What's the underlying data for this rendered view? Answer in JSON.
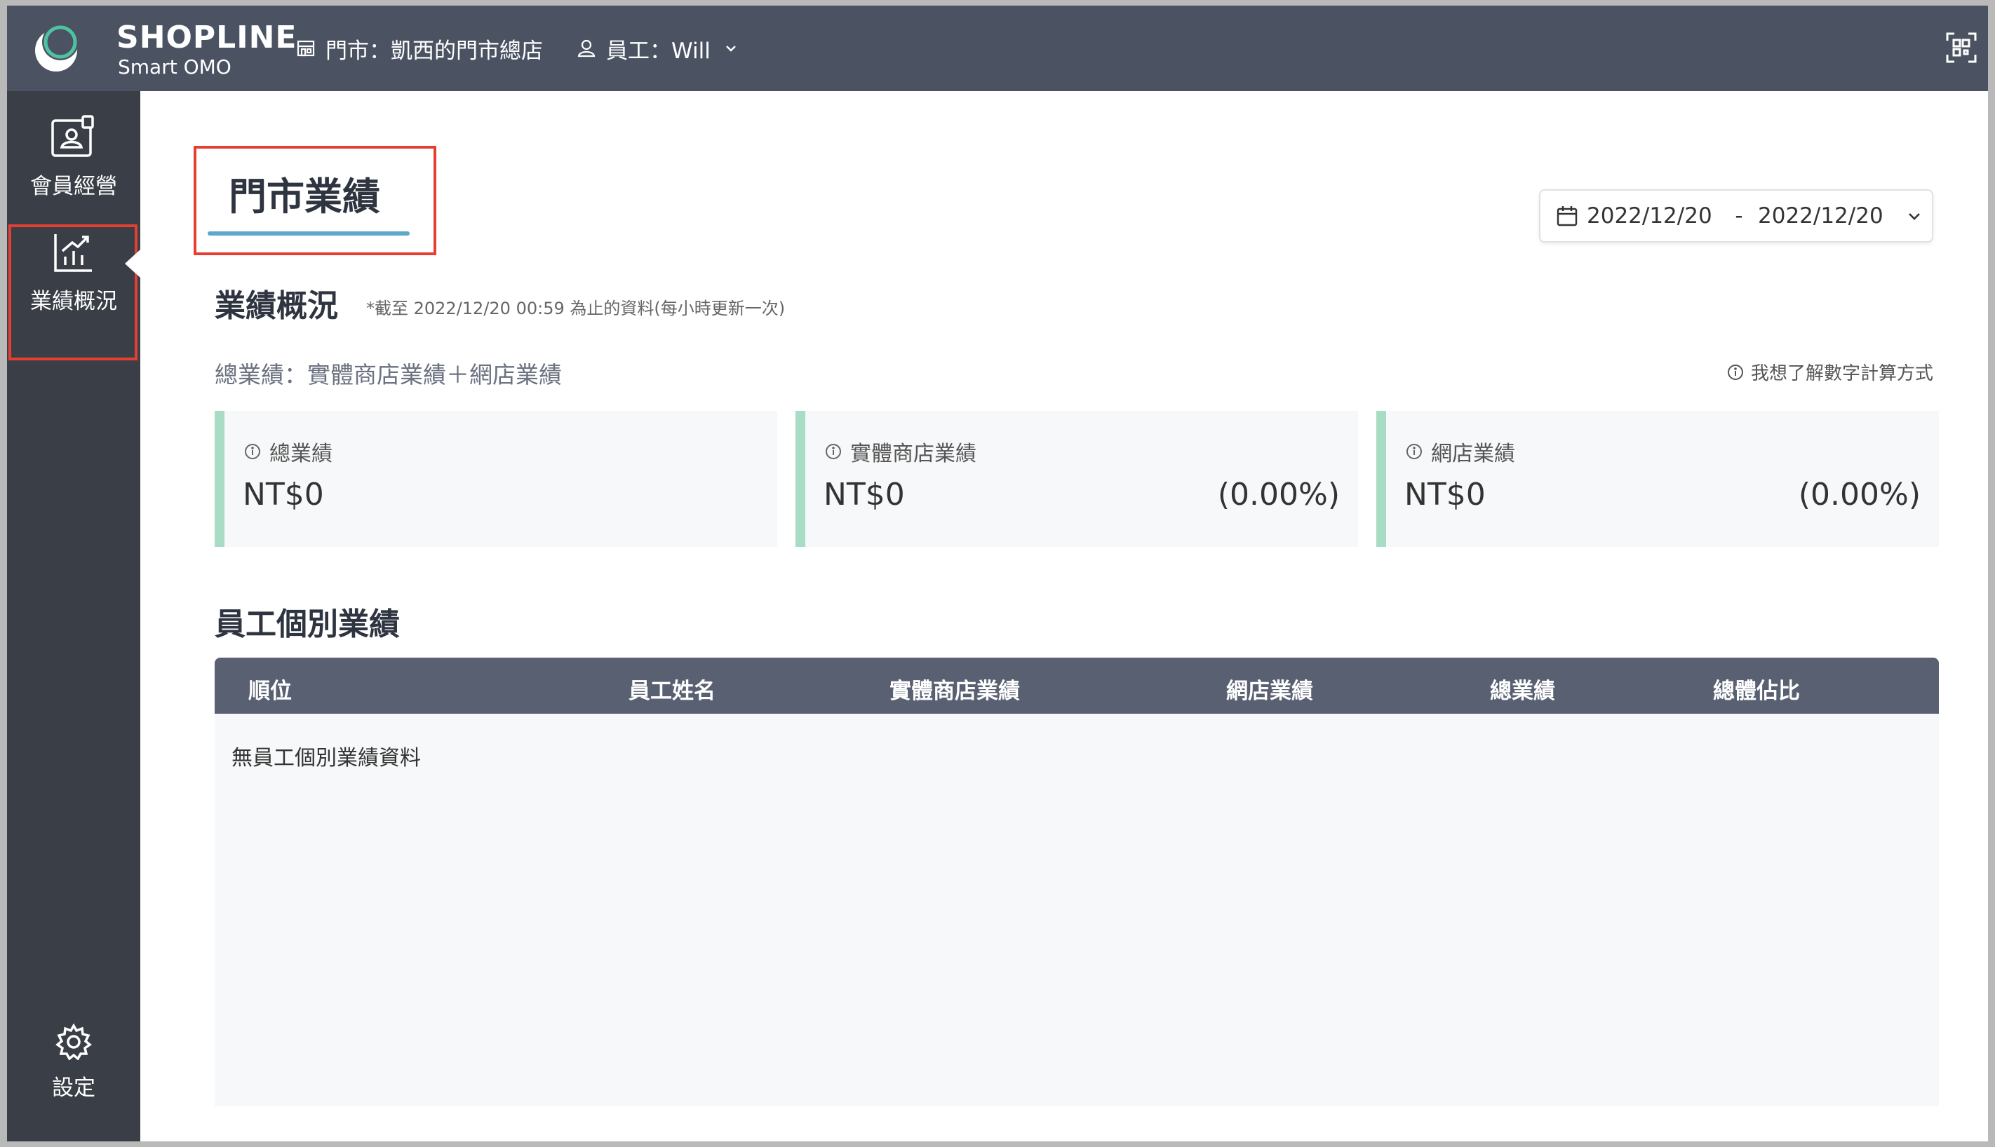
{
  "topbar": {
    "logo_main": "SHOPLINE",
    "logo_sub": "Smart OMO",
    "store_label": "門市：凱西的門市總店",
    "staff_label": "員工：Will",
    "icons": {
      "store": "store-icon",
      "staff": "user-icon",
      "dropdown": "chevron-down-icon",
      "scan": "scan-icon"
    }
  },
  "sidebar": {
    "items": [
      {
        "label": "會員經營",
        "icon": "member-card-icon"
      },
      {
        "label": "業績概況",
        "icon": "chart-icon",
        "active": true
      },
      {
        "label": "設定",
        "icon": "gear-icon"
      }
    ]
  },
  "page": {
    "tab_title": "門市業績",
    "date_range": {
      "start": "2022/12/20",
      "separator": "-",
      "end": "2022/12/20"
    },
    "overview": {
      "title": "業績概況",
      "note": "*截至 2022/12/20 00:59 為止的資料(每小時更新一次)",
      "formula": "總業績：實體商店業績＋網店業績",
      "calc_link": "我想了解數字計算方式"
    },
    "cards": [
      {
        "label": "總業績",
        "value": "NT$0",
        "pct": ""
      },
      {
        "label": "實體商店業績",
        "value": "NT$0",
        "pct": "(0.00%)"
      },
      {
        "label": "網店業績",
        "value": "NT$0",
        "pct": "(0.00%)"
      }
    ],
    "staff": {
      "title": "員工個別業績",
      "columns": [
        "順位",
        "員工姓名",
        "實體商店業績",
        "網店業績",
        "總業績",
        "總體佔比"
      ],
      "empty_text": "無員工個別業績資料"
    }
  },
  "colors": {
    "topbar": "#4b5362",
    "sidebar": "#3a3f47",
    "highlight_border": "#e53f33",
    "tab_underline": "#5fa7c9",
    "card_accent": "#a8dcc4",
    "table_header": "#586072",
    "logo_green": "#4fc3a1"
  }
}
